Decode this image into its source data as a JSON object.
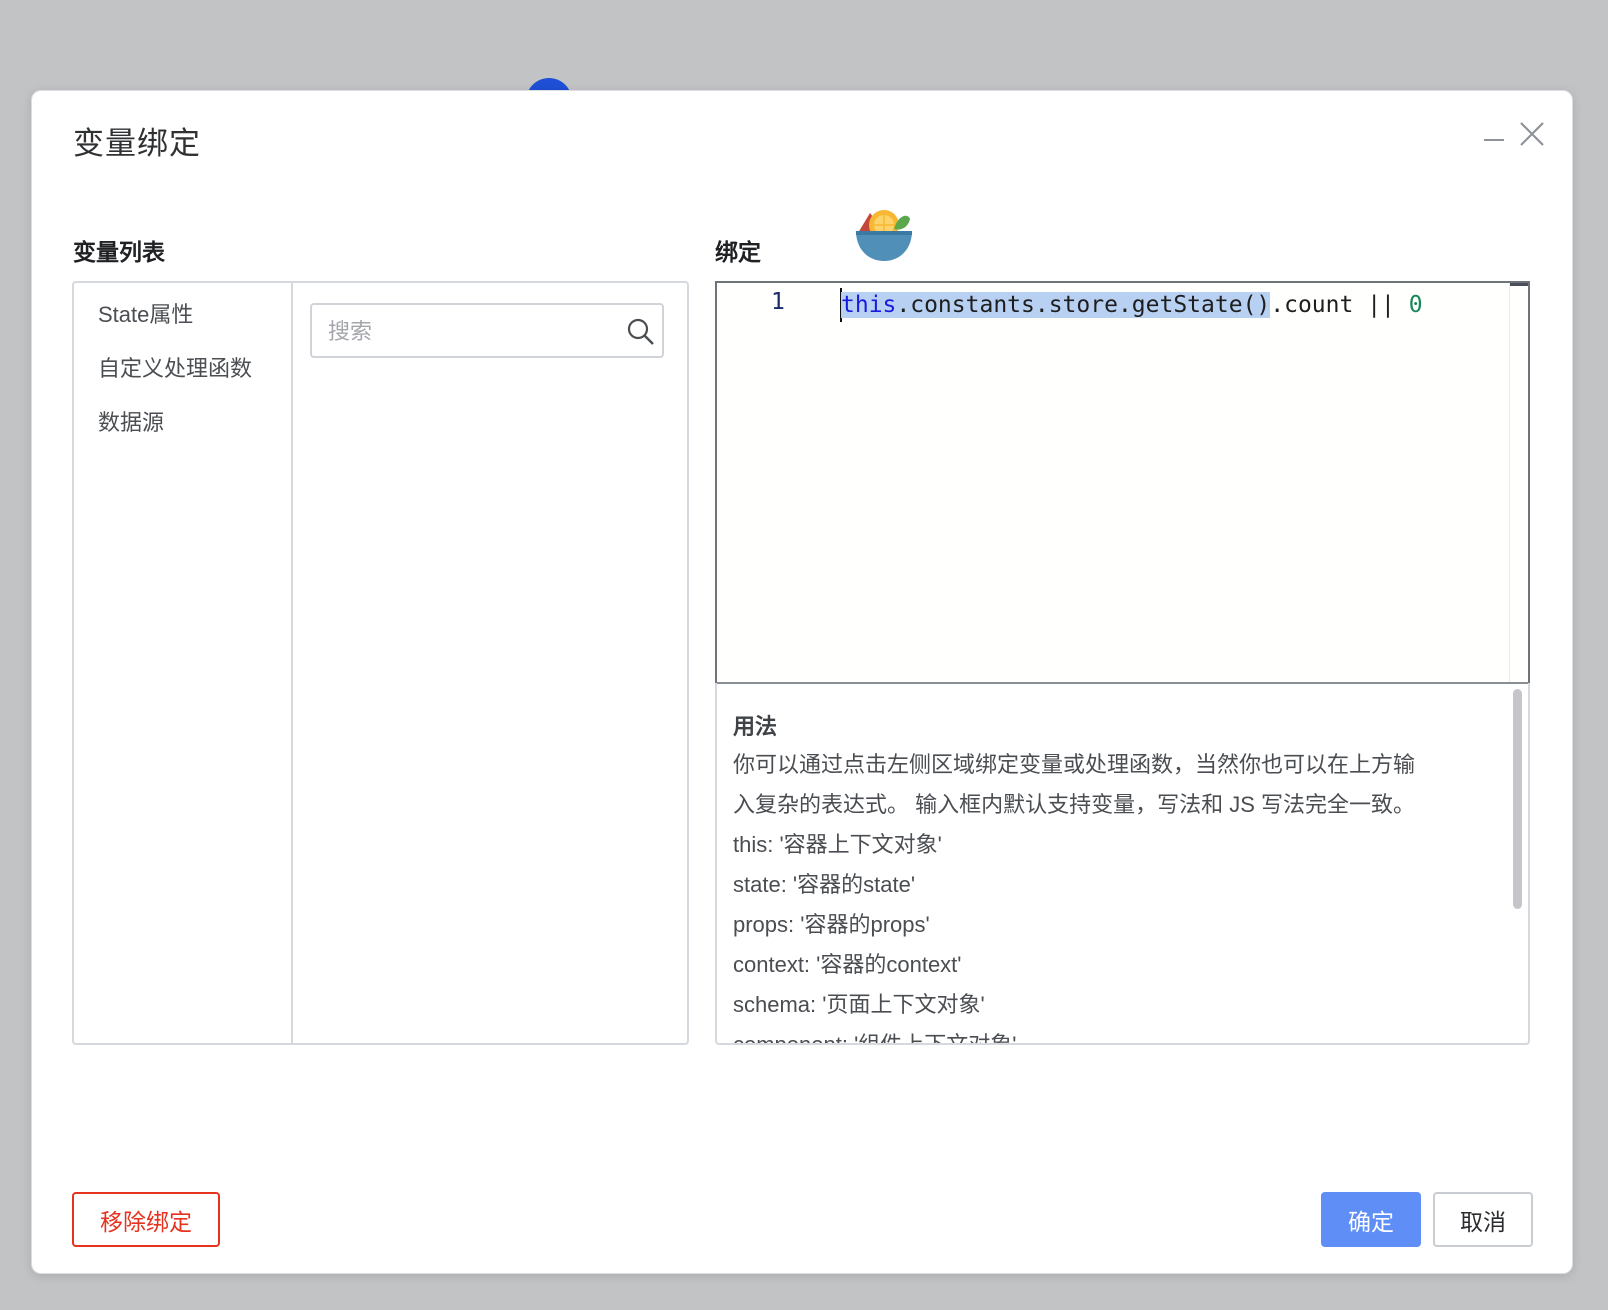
{
  "dialog": {
    "title": "变量绑定"
  },
  "variables_panel": {
    "label": "变量列表",
    "categories": [
      "State属性",
      "自定义处理函数",
      "数据源"
    ],
    "search_placeholder": "搜索"
  },
  "binding_panel": {
    "label": "绑定",
    "editor": {
      "line_number": "1",
      "code_keyword": "this",
      "code_selected_rest": ".constants.store.getState()",
      "code_after": ".count || ",
      "code_number": "0"
    }
  },
  "usage": {
    "title": "用法",
    "paragraph_line1": "你可以通过点击左侧区域绑定变量或处理函数，当然你也可以在上方输",
    "paragraph_line2": "入复杂的表达式。 输入框内默认支持变量，写法和 JS 写法完全一致。",
    "lines": [
      "this: '容器上下文对象'",
      "state: '容器的state'",
      "props: '容器的props'",
      "context: '容器的context'",
      "schema: '页面上下文对象'",
      "component: '组件上下文对象'"
    ]
  },
  "footer": {
    "remove_label": "移除绑定",
    "confirm_label": "确定",
    "cancel_label": "取消"
  },
  "colors": {
    "primary": "#5e8ef6",
    "danger": "#e5331f",
    "selection": "#b8d1f3"
  },
  "icons": [
    "minimize-icon",
    "close-icon",
    "search-icon",
    "fruit-bowl-icon"
  ]
}
